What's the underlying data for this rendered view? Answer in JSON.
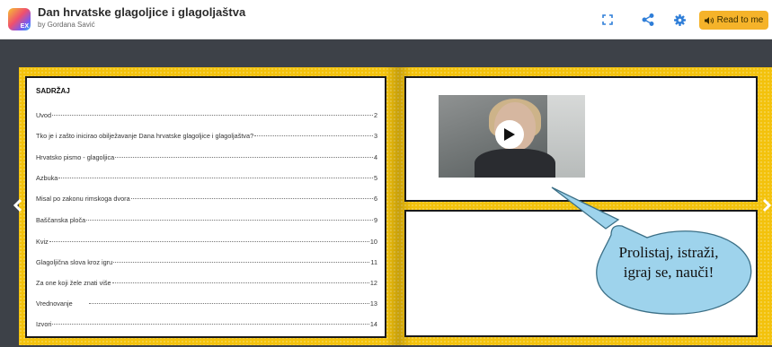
{
  "header": {
    "title": "Dan hrvatske glagoljice i glagoljaštva",
    "author": "by Gordana Savić",
    "logo_badge": "EX",
    "read_button": "Read to me",
    "icons": [
      "fullscreen-icon",
      "share-icon",
      "settings-icon",
      "speaker-icon"
    ],
    "accent_color": "#f5b32a"
  },
  "book": {
    "background_color": "#f3c20c",
    "toc": {
      "heading": "SADRŽAJ",
      "items": [
        {
          "label": "Uvod",
          "page": "2"
        },
        {
          "label": "Tko je i zašto inicirao obilježavanje Dana hrvatske glagoljice i glagoljaštva?",
          "page": "3"
        },
        {
          "label": "Hrvatsko pismo - glagoljica",
          "page": "4"
        },
        {
          "label": "Azbuka",
          "page": "5"
        },
        {
          "label": "Misal po zakonu rimskoga dvora",
          "page": "6"
        },
        {
          "label": "Baščanska ploča",
          "page": "9"
        },
        {
          "label": "Kviz",
          "page": "10"
        },
        {
          "label": "Glagoljična slova kroz igru",
          "page": "11"
        },
        {
          "label": "Za one koji žele znati više",
          "page": "12"
        },
        {
          "label": "Vrednovanje",
          "page": "13"
        },
        {
          "label": "Izvori",
          "page": "14"
        }
      ]
    },
    "speech_bubble": {
      "line1": "Prolistaj, istraži,",
      "line2": "igraj se, nauči!",
      "fill_color": "#9ed3ec"
    }
  },
  "navigation": {
    "prev_icon": "chevron-left-icon",
    "next_icon": "chevron-right-icon"
  }
}
